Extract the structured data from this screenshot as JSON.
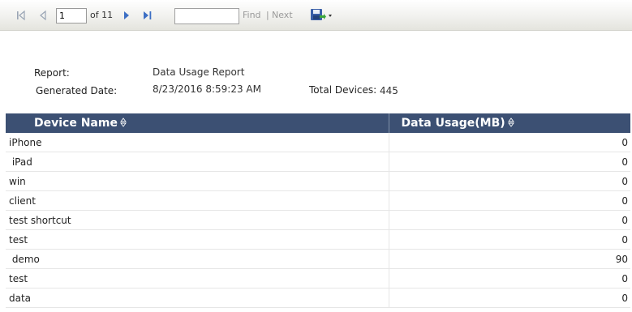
{
  "toolbar": {
    "page_number": "1",
    "page_of_label": "of 11",
    "find_placeholder": "",
    "find_label": "Find",
    "separator": "|",
    "next_label": "Next"
  },
  "report": {
    "report_label": "Report:",
    "report_value": "Data Usage Report",
    "generated_label": "Generated Date:",
    "generated_value": "8/23/2016 8:59:23 AM",
    "total_devices_label": "Total Devices:",
    "total_devices_value": "445"
  },
  "table": {
    "headers": [
      "Device Name",
      "Data Usage(MB)"
    ],
    "rows": [
      [
        "iPhone",
        "0"
      ],
      [
        " iPad",
        "0"
      ],
      [
        "win",
        "0"
      ],
      [
        "client",
        "0"
      ],
      [
        "test shortcut",
        "0"
      ],
      [
        "test",
        "0"
      ],
      [
        " demo",
        "90"
      ],
      [
        "test",
        "0"
      ],
      [
        "data",
        "0"
      ]
    ]
  },
  "colors": {
    "header_bg": "#3c5073",
    "nav_icon": "#3d6fc4",
    "disabled_icon": "#9aa5b5"
  }
}
